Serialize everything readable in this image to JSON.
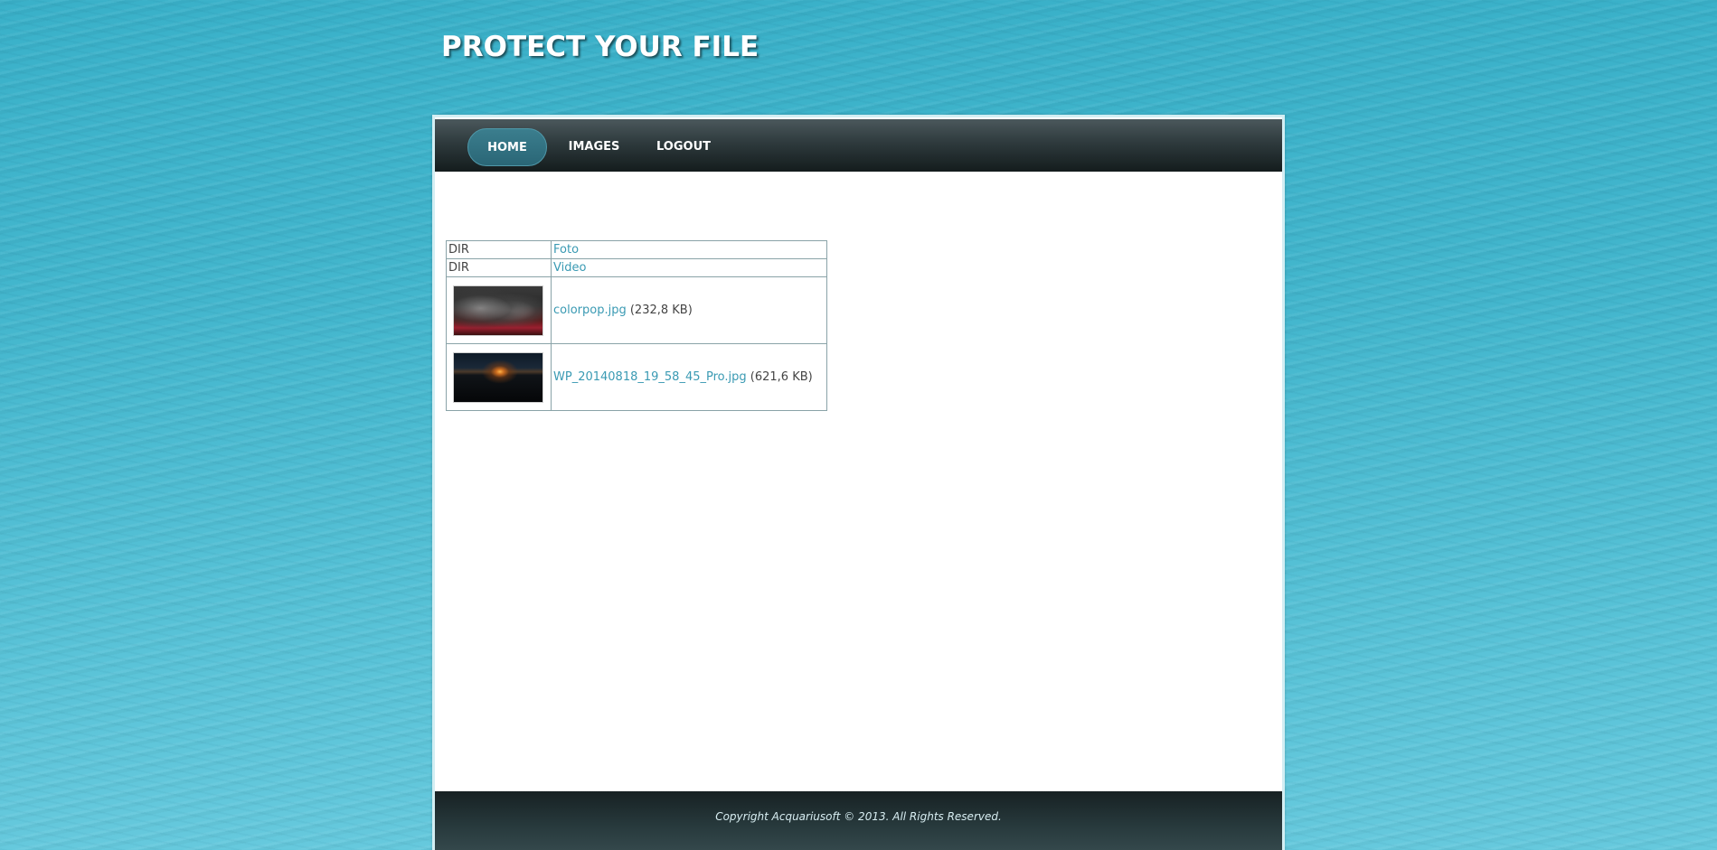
{
  "header": {
    "site_title": "PROTECT YOUR FILE"
  },
  "nav": {
    "items": [
      {
        "label": "HOME",
        "active": true
      },
      {
        "label": "IMAGES",
        "active": false
      },
      {
        "label": "LOGOUT",
        "active": false
      }
    ]
  },
  "files": {
    "rows": [
      {
        "type": "DIR",
        "name": "Foto",
        "size": ""
      },
      {
        "type": "DIR",
        "name": "Video",
        "size": ""
      },
      {
        "type": "image",
        "thumbnail_icon": "image-thumbnail",
        "name": "colorpop.jpg",
        "size": "(232,8 KB)"
      },
      {
        "type": "image",
        "thumbnail_icon": "image-thumbnail",
        "name": "WP_20140818_19_58_45_Pro.jpg",
        "size": "(621,6 KB)"
      }
    ]
  },
  "footer": {
    "copyright": "Copyright Acquariusoft © 2013. All Rights Reserved."
  },
  "colors": {
    "background": "#43b6cd",
    "nav_dark": "#1e2a2c",
    "nav_active": "#2f6f7f",
    "link": "#3a9ab3"
  }
}
